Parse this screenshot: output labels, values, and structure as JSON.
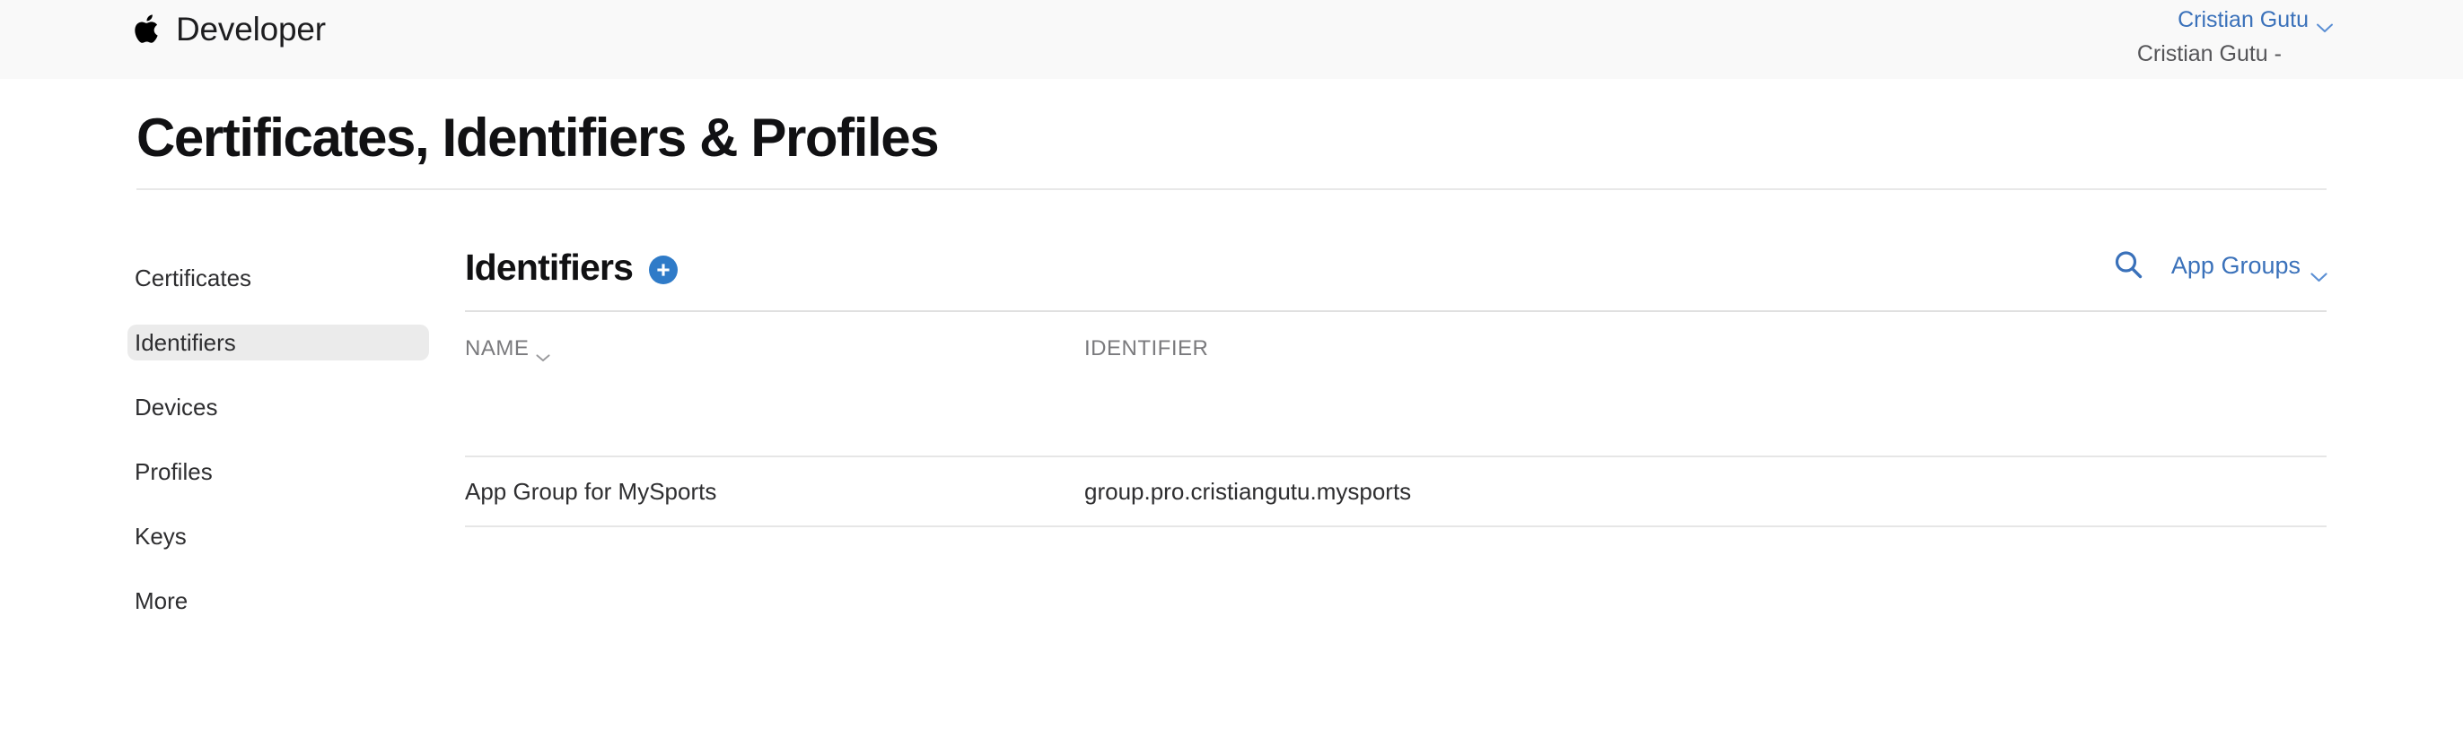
{
  "globalnav": {
    "apple_logo_icon": "apple-logo-icon",
    "brand": "Developer",
    "account_name": "Cristian Gutu",
    "account_chevron_icon": "chevron-down-icon",
    "team_name": "Cristian Gutu -"
  },
  "page": {
    "title": "Certificates, Identifiers & Profiles"
  },
  "sidebar": {
    "items": [
      {
        "label": "Certificates",
        "active": false
      },
      {
        "label": "Identifiers",
        "active": true
      },
      {
        "label": "Devices",
        "active": false
      },
      {
        "label": "Profiles",
        "active": false
      },
      {
        "label": "Keys",
        "active": false
      },
      {
        "label": "More",
        "active": false
      }
    ]
  },
  "main": {
    "heading": "Identifiers",
    "add_button_label": "+",
    "add_button_icon": "plus-icon",
    "search_icon": "search-icon",
    "filter": {
      "selected": "App Groups",
      "chevron_icon": "chevron-down-icon"
    },
    "table": {
      "columns": [
        "NAME",
        "IDENTIFIER"
      ],
      "sort_column": "NAME",
      "sort_icon": "chevron-down-icon",
      "rows": [
        {
          "name": "App Group for MySports",
          "identifier": "group.pro.cristiangutu.mysports"
        }
      ]
    }
  },
  "colors": {
    "accent_blue": "#3a71ba",
    "add_button_blue": "#2f7bc8",
    "navbar_background": "#f9f9f9",
    "active_item_background": "#ebebeb",
    "text_primary": "#2e2e30",
    "text_muted": "#7a7a7d",
    "divider": "#e6e6e6"
  }
}
